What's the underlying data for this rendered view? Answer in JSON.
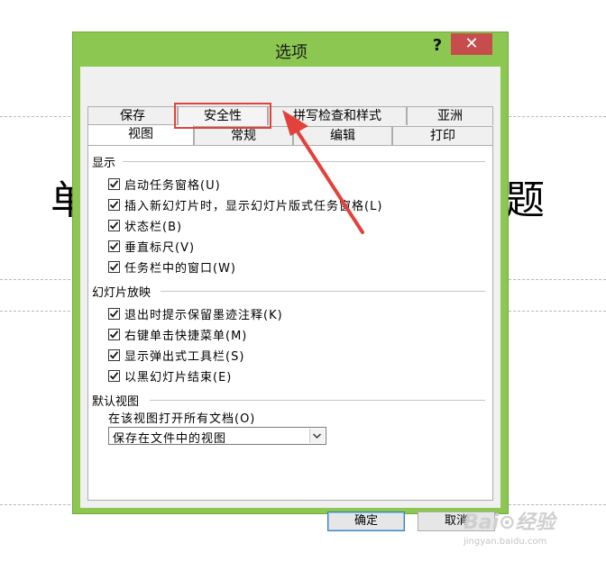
{
  "background": {
    "title_fragment_left": "单",
    "title_fragment_right": "题"
  },
  "dialog": {
    "title": "选项",
    "help_label": "?",
    "close_label": "✕",
    "tabs_back": [
      {
        "label": "保存"
      },
      {
        "label": "安全性"
      },
      {
        "label": "拼写检查和样式"
      },
      {
        "label": "亚洲"
      }
    ],
    "tabs_front": [
      {
        "label": "视图",
        "active": true
      },
      {
        "label": "常规"
      },
      {
        "label": "编辑"
      },
      {
        "label": "打印"
      }
    ],
    "sections": {
      "show": {
        "title": "显示",
        "items": [
          {
            "label": "启动任务窗格(U)",
            "checked": true
          },
          {
            "label": "插入新幻灯片时，显示幻灯片版式任务窗格(L)",
            "checked": true
          },
          {
            "label": "状态栏(B)",
            "checked": true
          },
          {
            "label": "垂直标尺(V)",
            "checked": true
          },
          {
            "label": "任务栏中的窗口(W)",
            "checked": true
          }
        ]
      },
      "slideshow": {
        "title": "幻灯片放映",
        "items": [
          {
            "label": "退出时提示保留墨迹注释(K)",
            "checked": true
          },
          {
            "label": "右键单击快捷菜单(M)",
            "checked": true
          },
          {
            "label": "显示弹出式工具栏(S)",
            "checked": true
          },
          {
            "label": "以黑幻灯片结束(E)",
            "checked": true
          }
        ]
      },
      "default_view": {
        "title": "默认视图",
        "field_label": "在该视图打开所有文档(O)",
        "selected": "保存在文件中的视图"
      }
    },
    "ok_label": "确定",
    "cancel_label": "取消"
  },
  "annotation": {
    "highlight_color": "#e3423b",
    "highlighted_tab": "安全性"
  },
  "watermark": {
    "logo": "Bai⊙经验",
    "url": "jingyan.baidu.com"
  }
}
